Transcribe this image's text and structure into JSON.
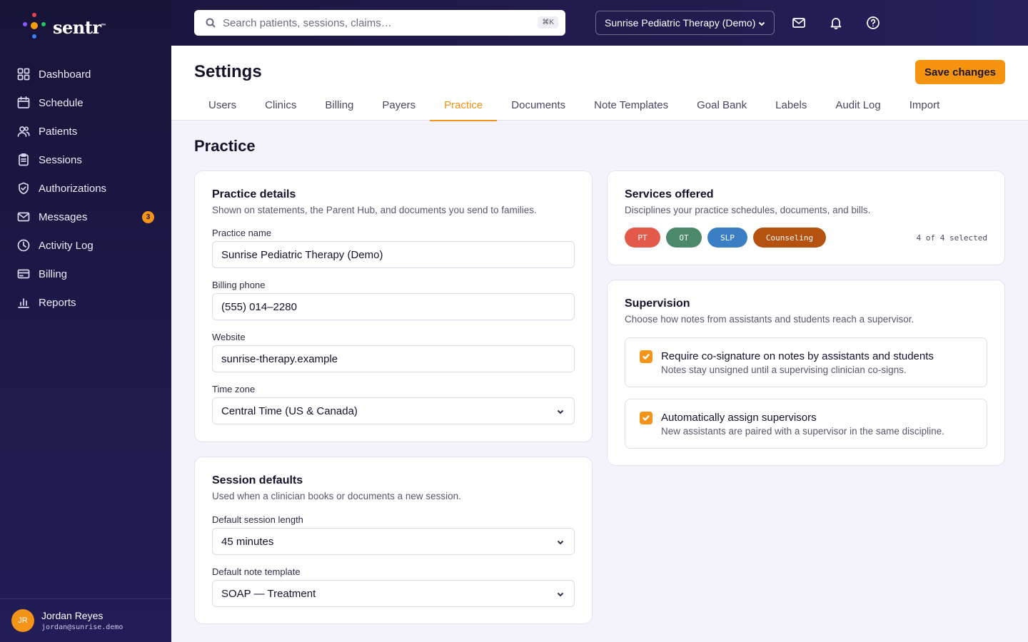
{
  "brand": {
    "name": "sentr",
    "mark": "™"
  },
  "sidebar": {
    "items": [
      {
        "label": "Dashboard",
        "icon": "grid-icon"
      },
      {
        "label": "Schedule",
        "icon": "calendar-icon"
      },
      {
        "label": "Patients",
        "icon": "users-icon"
      },
      {
        "label": "Sessions",
        "icon": "clipboard-icon"
      },
      {
        "label": "Authorizations",
        "icon": "shield-check-icon"
      },
      {
        "label": "Messages",
        "icon": "mail-icon",
        "badge": "3"
      },
      {
        "label": "Activity Log",
        "icon": "clock-icon"
      },
      {
        "label": "Billing",
        "icon": "credit-card-icon"
      },
      {
        "label": "Reports",
        "icon": "bar-chart-icon"
      }
    ]
  },
  "user": {
    "initials": "JR",
    "name": "Jordan Reyes",
    "email": "jordan@sunrise.demo"
  },
  "topbar": {
    "search_placeholder": "Search patients, sessions, claims…",
    "shortcut": "⌘K",
    "practice": "Sunrise Pediatric Therapy (Demo)"
  },
  "header": {
    "title": "Settings",
    "save_label": "Save changes",
    "tabs": [
      "Users",
      "Clinics",
      "Billing",
      "Payers",
      "Practice",
      "Documents",
      "Note Templates",
      "Goal Bank",
      "Labels",
      "Audit Log",
      "Import"
    ],
    "active_tab": "Practice"
  },
  "section_title": "Practice",
  "practice_details": {
    "title": "Practice details",
    "subtitle": "Shown on statements, the Parent Hub, and documents you send to families.",
    "name_label": "Practice name",
    "name_value": "Sunrise Pediatric Therapy (Demo)",
    "phone_label": "Billing phone",
    "phone_value": "(555) 014–2280",
    "website_label": "Website",
    "website_value": "sunrise-therapy.example",
    "timezone_label": "Time zone",
    "timezone_value": "Central Time (US & Canada)"
  },
  "session_defaults": {
    "title": "Session defaults",
    "subtitle": "Used when a clinician books or documents a new session.",
    "length_label": "Default session length",
    "length_value": "45 minutes",
    "template_label": "Default note template",
    "template_value": "SOAP — Treatment"
  },
  "services": {
    "title": "Services offered",
    "subtitle": "Disciplines your practice schedules, documents, and bills.",
    "chips": [
      {
        "label": "PT",
        "color": "#e35a4b"
      },
      {
        "label": "OT",
        "color": "#4a8a6a"
      },
      {
        "label": "SLP",
        "color": "#3a7fc4"
      },
      {
        "label": "Counseling",
        "color": "#b5520f"
      }
    ],
    "selected_text": "4 of 4 selected"
  },
  "supervision": {
    "title": "Supervision",
    "subtitle": "Choose how notes from assistants and students reach a supervisor.",
    "options": [
      {
        "title": "Require co-signature on notes by assistants and students",
        "desc": "Notes stay unsigned until a supervising clinician co-signs.",
        "checked": true
      },
      {
        "title": "Automatically assign supervisors",
        "desc": "New assistants are paired with a supervisor in the same discipline.",
        "checked": true
      }
    ]
  },
  "colors": {
    "accent": "#f39318",
    "sidebar": "#1d1947",
    "page_bg": "#f4f3fb"
  }
}
